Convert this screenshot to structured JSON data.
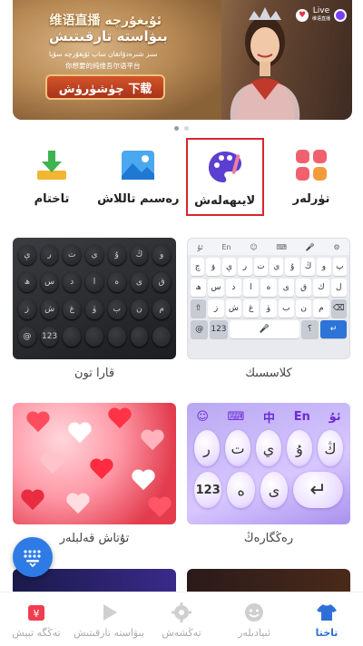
{
  "banner": {
    "title_line1": "维语直播 ئۇيغۇرچە",
    "title_line2": "بىۋاستە تارقىتىش",
    "subtitle_line1": "سىز شىرەدۇاتقان ساپ ئۇيغۇرچە سۇپا",
    "subtitle_line2": "你想要的纯维吾尔语平台",
    "download_label": "چۈشۈرۈش 下载",
    "live_label": "Live",
    "live_sub": "维语直播"
  },
  "categories": [
    {
      "label": "تاختام",
      "icon": "download-icon"
    },
    {
      "label": "رەسىم تاللاش",
      "icon": "image-icon"
    },
    {
      "label": "لايىھەلەش",
      "icon": "palette-icon",
      "selected": true
    },
    {
      "label": "تۈرلەر",
      "icon": "grid-apps-icon"
    }
  ],
  "skins": [
    {
      "name": "قارا تون"
    },
    {
      "name": "كلاسسىك"
    },
    {
      "name": "تۇتاش قەلبلەر"
    },
    {
      "name": "رەڭگارەڭ"
    }
  ],
  "classic_keys": {
    "top": [
      "ئۇ",
      "En",
      "☺",
      "⌨",
      "🎤",
      "⚙"
    ],
    "row1": [
      "چ",
      "ۋ",
      "ې",
      "ر",
      "ت",
      "ي",
      "ۇ",
      "ڭ",
      "و",
      "پ"
    ],
    "row2": [
      "ھ",
      "س",
      "د",
      "ا",
      "ە",
      "ى",
      "ق",
      "ك",
      "ل"
    ],
    "row3": [
      "ز",
      "ش",
      "غ",
      "ۈ",
      "ب",
      "ن",
      "م"
    ],
    "bottom": [
      "@",
      "123",
      "؟",
      "↵"
    ]
  },
  "dark_keys": {
    "row1": [
      "ې",
      "ر",
      "ت",
      "ي",
      "ۇ",
      "ڭ",
      "و"
    ],
    "row2": [
      "ھ",
      "س",
      "د",
      "ا",
      "ە",
      "ى",
      "ق"
    ],
    "row3": [
      "ز",
      "ش",
      "غ",
      "ۈ",
      "ب",
      "ن",
      "م"
    ],
    "bottom": [
      "@",
      "123",
      "",
      "",
      "",
      "",
      ""
    ]
  },
  "purple_keys": {
    "top": [
      "☺",
      "⌨",
      "中",
      "En",
      "ئۇ"
    ],
    "row1": [
      "ر",
      "ت",
      "ي",
      "ۇ",
      "ڭ"
    ],
    "row2": [
      "123",
      "ە",
      "ى",
      "↵"
    ]
  },
  "nav": [
    {
      "label": "تەڭگە تېپش",
      "icon": "gift-icon"
    },
    {
      "label": "بىۋاستە تارقىتىش",
      "icon": "play-icon"
    },
    {
      "label": "تەڭشەش",
      "icon": "gear-icon"
    },
    {
      "label": "ئىپادىلەر",
      "icon": "emoji-icon"
    },
    {
      "label": "تاختا",
      "icon": "shirt-icon",
      "active": true
    }
  ],
  "colors": {
    "accent": "#2d6fd6",
    "selected_border": "#d8262e"
  }
}
